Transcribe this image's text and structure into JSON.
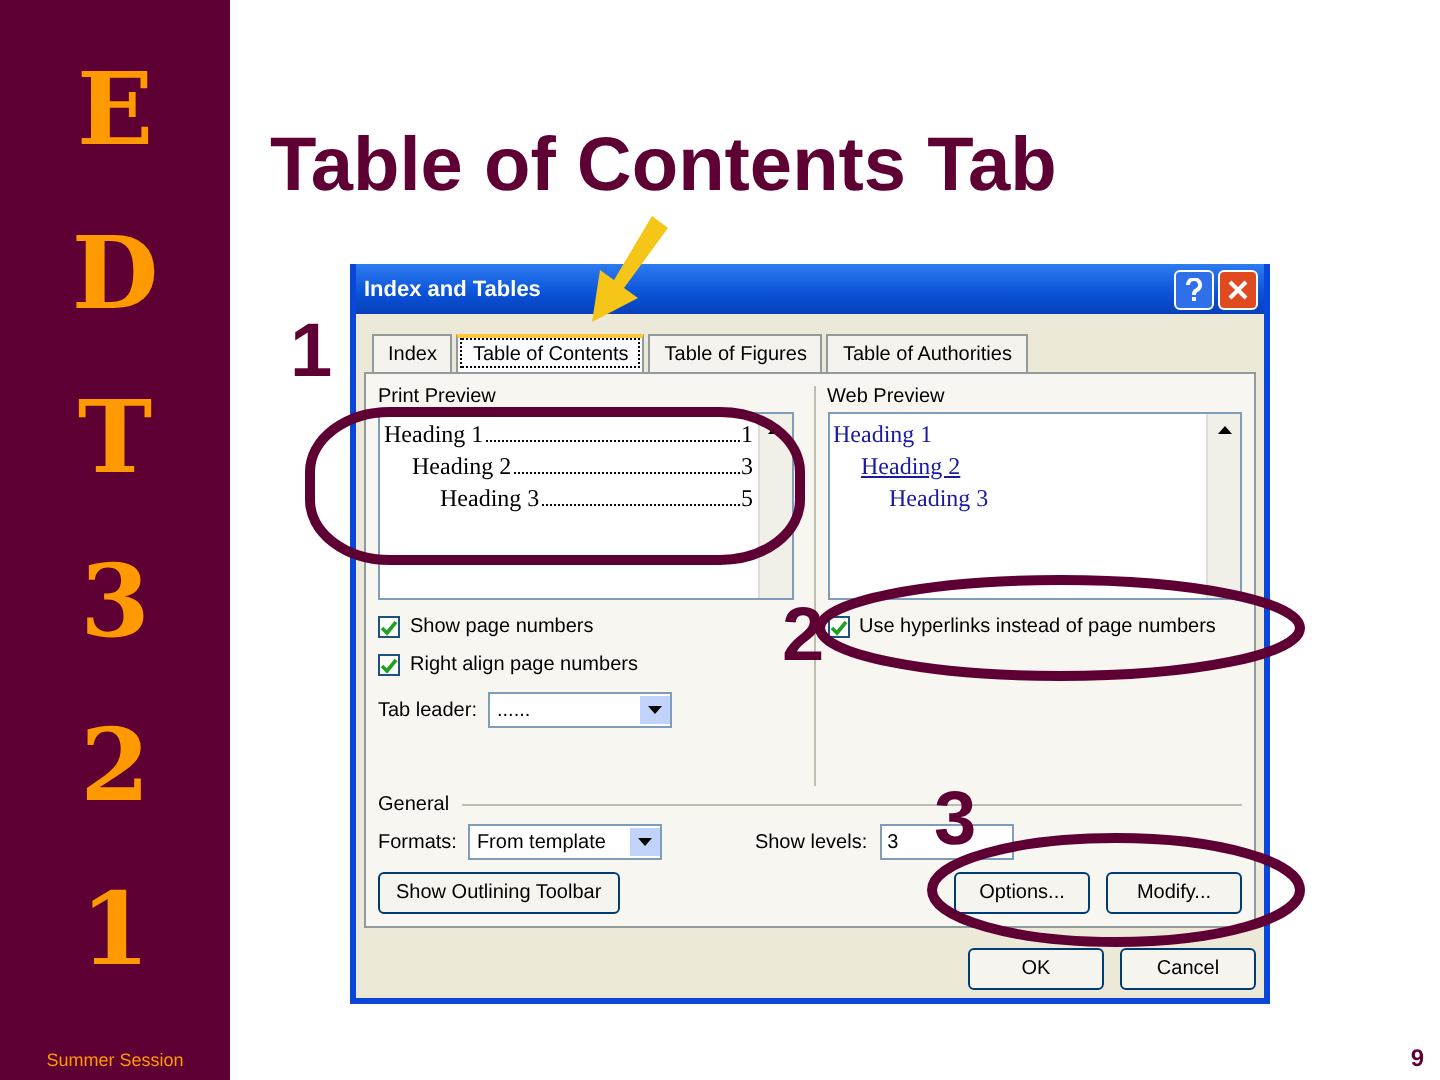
{
  "sidebar": {
    "letters": [
      "E",
      "D",
      "T",
      "3",
      "2",
      "1"
    ],
    "footer": "Summer Session"
  },
  "slide": {
    "title": "Table of Contents Tab",
    "page_number": "9",
    "callouts": [
      "1",
      "2",
      "3"
    ]
  },
  "dialog": {
    "title": "Index and Tables",
    "tabs": [
      {
        "label": "Index",
        "selected": false
      },
      {
        "label": "Table of Contents",
        "selected": true
      },
      {
        "label": "Table of Figures",
        "selected": false
      },
      {
        "label": "Table of Authorities",
        "selected": false
      }
    ],
    "print_preview": {
      "label": "Print Preview",
      "entries": [
        {
          "text": "Heading 1",
          "page": "1"
        },
        {
          "text": "Heading 2",
          "page": "3"
        },
        {
          "text": "Heading 3",
          "page": "5"
        }
      ]
    },
    "web_preview": {
      "label": "Web Preview",
      "entries": [
        {
          "text": "Heading 1",
          "underlined": false
        },
        {
          "text": "Heading 2",
          "underlined": true
        },
        {
          "text": "Heading 3",
          "underlined": false
        }
      ]
    },
    "options": [
      {
        "label": "Show page numbers",
        "checked": true
      },
      {
        "label": "Right align page numbers",
        "checked": true
      }
    ],
    "tab_leader": {
      "label": "Tab leader:",
      "value": "......"
    },
    "hyperlinks": {
      "label": "Use hyperlinks instead of page numbers",
      "checked": true
    },
    "general": {
      "label": "General",
      "format": {
        "label": "Formats:",
        "value": "From template"
      },
      "show_levels": {
        "label": "Show levels:",
        "value": "3"
      }
    },
    "panel_buttons": [
      "Show Outlining Toolbar",
      "Options...",
      "Modify..."
    ],
    "footer_buttons": [
      "OK",
      "Cancel"
    ]
  }
}
